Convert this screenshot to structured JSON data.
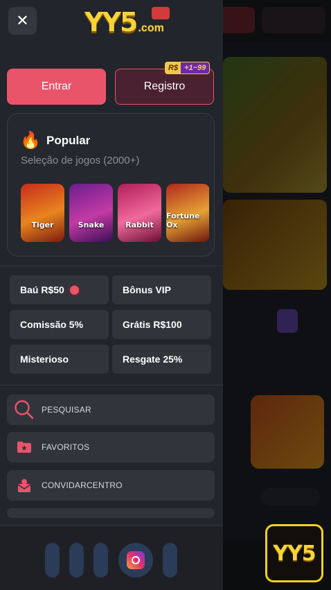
{
  "header": {
    "close_label": "✕",
    "logo_text": "YY5",
    "logo_domain": ".com"
  },
  "auth": {
    "login_label": "Entrar",
    "register_label": "Registro",
    "register_badge_currency": "R$",
    "register_badge_amount": "+1~99"
  },
  "popular": {
    "title": "Popular",
    "subtitle": "Seleção de jogos (2000+)",
    "games": [
      {
        "name": "Tiger"
      },
      {
        "name": "Snake"
      },
      {
        "name": "Rabbit"
      },
      {
        "name": "Fortune Ox"
      }
    ]
  },
  "bonus_tiles": [
    {
      "label": "Baú R$50"
    },
    {
      "label": "Bônus VIP"
    },
    {
      "label": "Comissão 5%"
    },
    {
      "label": "Grátis R$100"
    },
    {
      "label": "Misterioso"
    },
    {
      "label": "Resgate 25%"
    }
  ],
  "menu": {
    "items": [
      {
        "label": "PESQUISAR",
        "icon": "search-icon"
      },
      {
        "label": "FAVORITOS",
        "icon": "folder-star-icon"
      },
      {
        "label": "CONVIDARCENTRO",
        "icon": "mail-user-icon"
      }
    ]
  },
  "colors": {
    "accent": "#e9546a",
    "drawer_bg": "#22252b",
    "tile_bg": "#31343b",
    "badge_gold": "#f0c94a"
  },
  "app_badge": {
    "text": "YY5"
  }
}
